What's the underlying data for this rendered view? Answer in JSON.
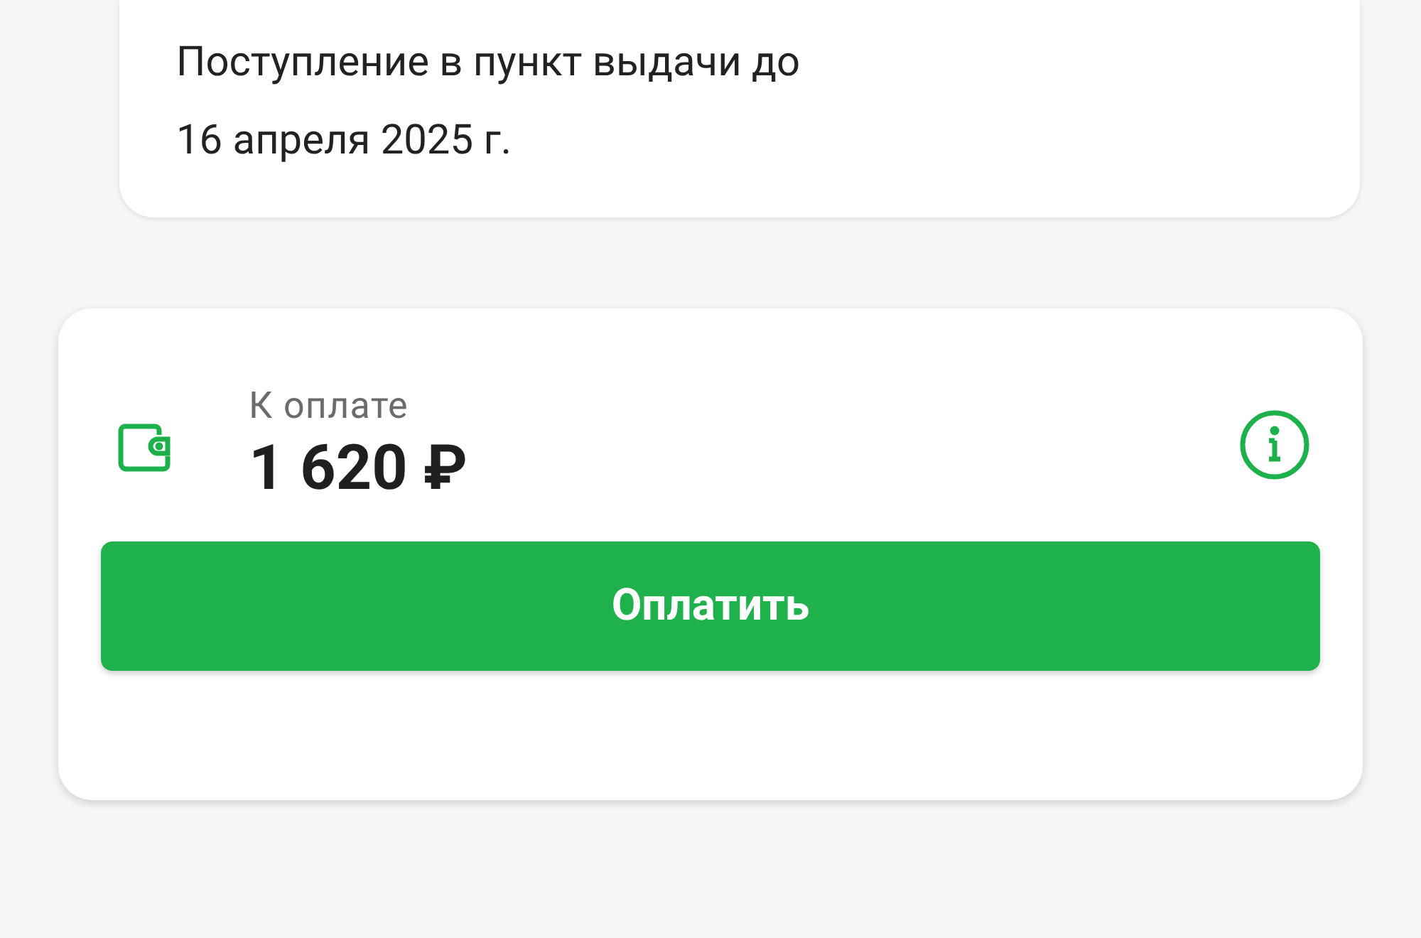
{
  "delivery_card": {
    "text": "Поступление в пункт выдачи до\n16 апреля 2025 г."
  },
  "payment_card": {
    "label": "К оплате",
    "amount": "1 620 ₽",
    "button": "Оплатить"
  }
}
